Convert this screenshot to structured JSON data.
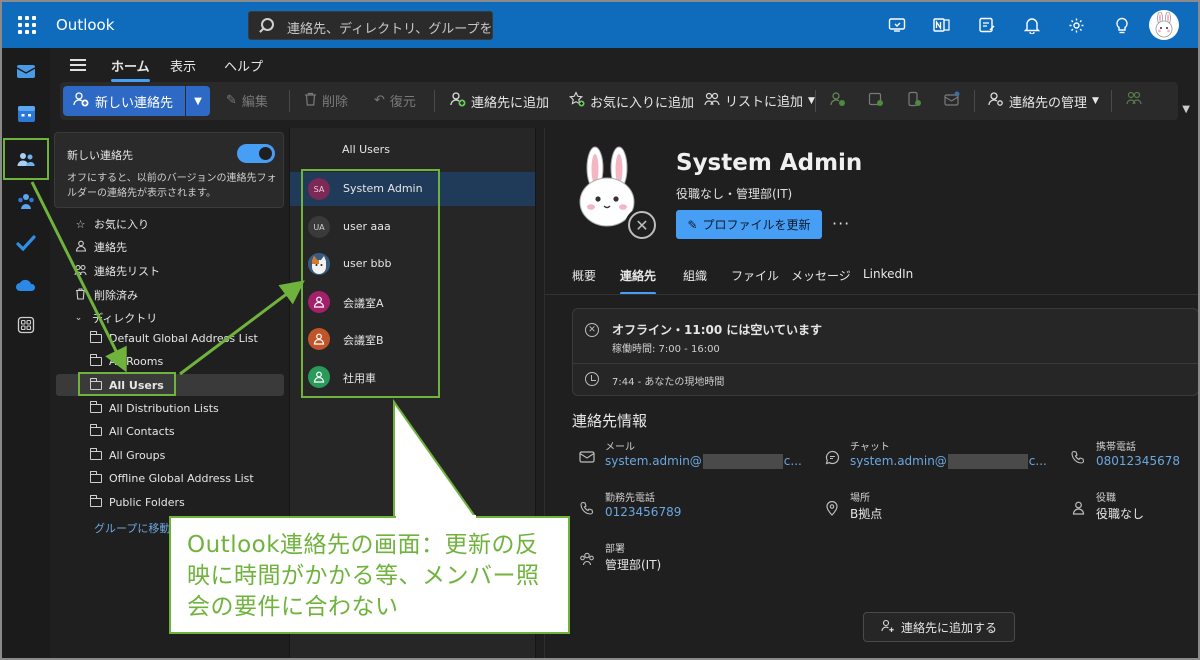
{
  "app": {
    "title": "Outlook"
  },
  "search": {
    "placeholder": "連絡先、ディレクトリ、グループを検索..."
  },
  "tabs": [
    {
      "label": "ホーム",
      "active": true
    },
    {
      "label": "表示"
    },
    {
      "label": "ヘルプ"
    }
  ],
  "ribbon": {
    "new_contact": "新しい連絡先",
    "edit": "編集",
    "delete": "削除",
    "restore": "復元",
    "add_to_contacts": "連絡先に追加",
    "add_to_favorites": "お気に入りに追加",
    "add_to_list": "リストに追加",
    "manage_contacts": "連絡先の管理"
  },
  "toggle_card": {
    "title": "新しい連絡先",
    "desc": "オフにすると、以前のバージョンの連絡先フォルダーの連絡先が表示されます。",
    "on": true
  },
  "folders": {
    "favorites": "お気に入り",
    "contacts": "連絡先",
    "contact_lists": "連絡先リスト",
    "deleted": "削除済み",
    "directory": "ディレクトリ",
    "directory_items": [
      "Default Global Address List",
      "All Rooms",
      "All Users",
      "All Distribution Lists",
      "All Contacts",
      "All Groups",
      "Offline Global Address List",
      "Public Folders"
    ],
    "goto_groups": "グループに移動"
  },
  "contact_list": {
    "header": "All Users",
    "items": [
      {
        "initials": "SA",
        "name": "System Admin",
        "color": "#7a2a55"
      },
      {
        "initials": "UA",
        "name": "user aaa",
        "color": "#3a3a3a"
      },
      {
        "initials": "",
        "name": "user bbb",
        "color": "#3a5a80"
      },
      {
        "initials": "",
        "name": "会議室A",
        "color": "#a3206a"
      },
      {
        "initials": "",
        "name": "会議室B",
        "color": "#c0552a"
      },
      {
        "initials": "",
        "name": "社用車",
        "color": "#2a9a5a"
      }
    ]
  },
  "detail": {
    "name": "System Admin",
    "subtitle": "役職なし・管理部(IT)",
    "update_profile": "プロファイルを更新",
    "more": "···",
    "tabs": [
      "概要",
      "連絡先",
      "組織",
      "ファイル",
      "メッセージ",
      "LinkedIn"
    ],
    "availability": {
      "status": "オフライン・11:00 には空いています",
      "hours": "稼働時間: 7:00 - 16:00",
      "local_time": "7:44 - あなたの現地時間"
    },
    "contact_info_title": "連絡先情報",
    "fields": {
      "mail_label": "メール",
      "mail_pre": "system.admin@",
      "mail_post": "c...",
      "chat_label": "チャット",
      "chat_pre": "system.admin@",
      "chat_post": "c...",
      "mobile_label": "携帯電話",
      "mobile_value": "08012345678",
      "work_phone_label": "勤務先電話",
      "work_phone_value": "0123456789",
      "location_label": "場所",
      "location_value": "B拠点",
      "title_label": "役職",
      "title_value": "役職なし",
      "dept_label": "部署",
      "dept_value": "管理部(IT)"
    },
    "add_to_contacts": "連絡先に追加する"
  },
  "annotation": {
    "text": "Outlook連絡先の画面：更新の反映に時間がかかる等、メンバー照会の要件に合わない"
  },
  "colors": {
    "brand": "#0f6cbd",
    "accent": "#479ef5",
    "annotation": "#6fb33d"
  }
}
